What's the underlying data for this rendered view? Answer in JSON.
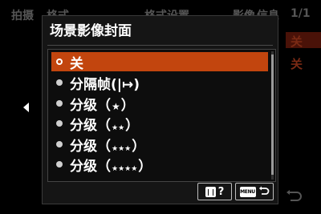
{
  "background": {
    "left_title": "拍摄",
    "mid_text_1": "格式",
    "mid_text_2": "格式设置",
    "mid_text_3": "影像",
    "mid_text_4": "信息",
    "page_indicator": "1/1",
    "right_value_1": "关",
    "right_value_2": "关"
  },
  "dialog": {
    "title": "场景影像封面",
    "options": [
      {
        "label": "关",
        "selected": true
      },
      {
        "label": "分隔帧(|↦)",
        "selected": false
      },
      {
        "label": "分级（",
        "stars": "★",
        "suffix": "）",
        "selected": false
      },
      {
        "label": "分级（",
        "stars": "★★",
        "suffix": "）",
        "selected": false
      },
      {
        "label": "分级（",
        "stars": "★★★",
        "suffix": "）",
        "selected": false
      },
      {
        "label": "分级（",
        "stars": "★★★★",
        "suffix": "）",
        "selected": false
      }
    ],
    "help_button": {
      "glyph": "?"
    },
    "menu_button": {
      "text": "MENU"
    }
  },
  "colors": {
    "selection": "#c2450e",
    "dialog_bg": "#151515",
    "background_accent": "#4a1208"
  },
  "icons": [
    "left-arrow-icon",
    "trash-icon",
    "help-icon",
    "menu-icon",
    "return-icon",
    "back-icon"
  ]
}
